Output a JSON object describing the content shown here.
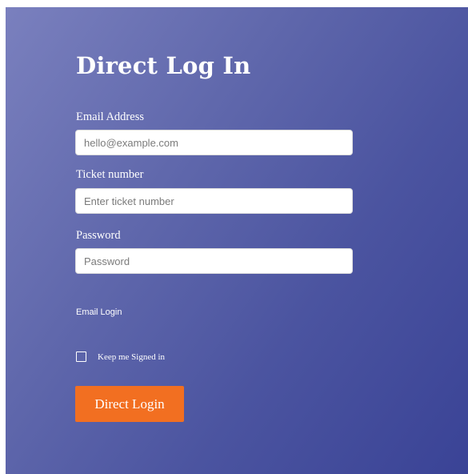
{
  "form": {
    "title": "Direct Log In",
    "email": {
      "label": "Email Address",
      "placeholder": "hello@example.com"
    },
    "ticket": {
      "label": "Ticket number",
      "placeholder": "Enter ticket number"
    },
    "password": {
      "label": "Password",
      "placeholder": "Password"
    },
    "email_login_link": "Email Login",
    "remember": {
      "label": "Keep me Signed in",
      "checked": false
    },
    "submit_label": "Direct Login"
  },
  "colors": {
    "panel_gradient_start": "#7a80be",
    "panel_gradient_end": "#3a4396",
    "button_bg": "#f26f21",
    "text": "#ffffff"
  },
  "icons": {
    "checkbox": "unchecked-checkbox-icon"
  }
}
